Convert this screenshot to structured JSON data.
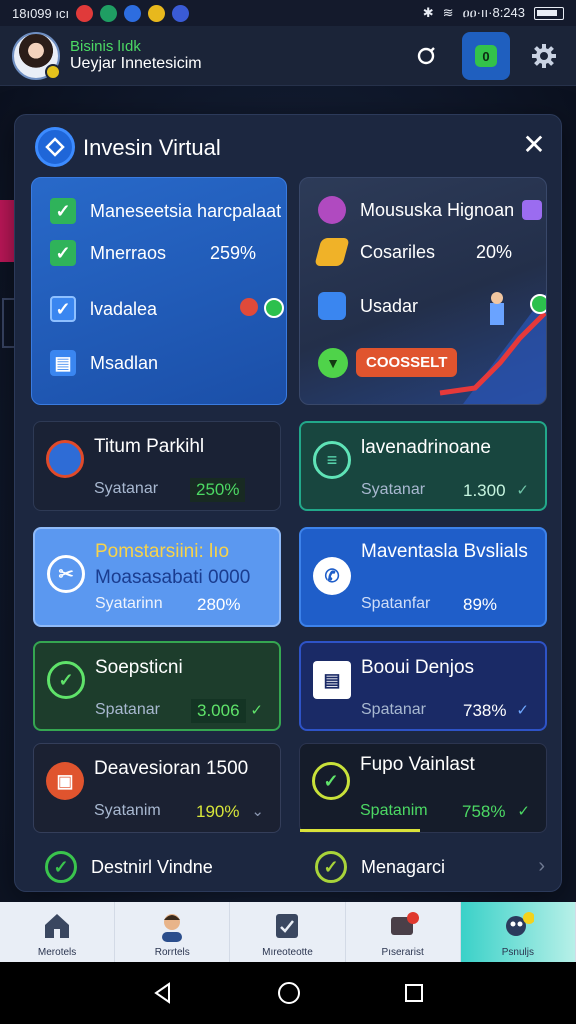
{
  "status_bar": {
    "left_text": "18ı099 ıcı",
    "right_text": "ዐዐ·ıı·8:243"
  },
  "header": {
    "title": "Bisinis lıdk",
    "subtitle": "Ueyjar Innetesicim"
  },
  "modal": {
    "title": "Invesin Virtual",
    "close_label": "✕",
    "left_panel": {
      "row1": "Maneseetsia harcpalaat",
      "row2_label": "Mnerraos",
      "row2_value": "259%",
      "row3": "lvadalea",
      "row4": "Msadlan"
    },
    "right_panel": {
      "row1": "Moususka Hignoan",
      "row2_label": "Cosariles",
      "row2_value": "20%",
      "row3": "Usadar",
      "button_label": "COOSSELT"
    },
    "cards": [
      {
        "title": "Titum Parkihl",
        "sub": "Syatanar",
        "value": "250%"
      },
      {
        "title": "lavenadrinoane",
        "sub": "Syatanar",
        "value": "1.300"
      },
      {
        "title": "Pomstarsiini: lıo",
        "title2": "Moasasabati 0000",
        "sub": "Syatarinn",
        "value": "280%"
      },
      {
        "title": "Maventasla Bvslials",
        "sub": "Spatanfar",
        "value": "89%"
      },
      {
        "title": "Soepsticni",
        "sub": "Spatanar",
        "value": "3.006"
      },
      {
        "title": "Booui Denjos",
        "sub": "Spatanar",
        "value": "738%"
      },
      {
        "title": "Deavesioran 1500",
        "sub": "Syatanim",
        "value": "190%"
      },
      {
        "title": "Fupo Vainlast",
        "sub": "Spatanim",
        "value": "758%"
      }
    ],
    "bottom_left": "Destnirl Vindne",
    "bottom_right": "Menagarci"
  },
  "tabs": [
    {
      "label": "Merotels"
    },
    {
      "label": "Rorrtels"
    },
    {
      "label": "Mıreoteotte"
    },
    {
      "label": "Pıserarist"
    },
    {
      "label": "Psnuljs"
    }
  ],
  "colors": {
    "accent": "#1f5fbf",
    "green": "#4cd964",
    "modal_bg": "#1c2740"
  }
}
